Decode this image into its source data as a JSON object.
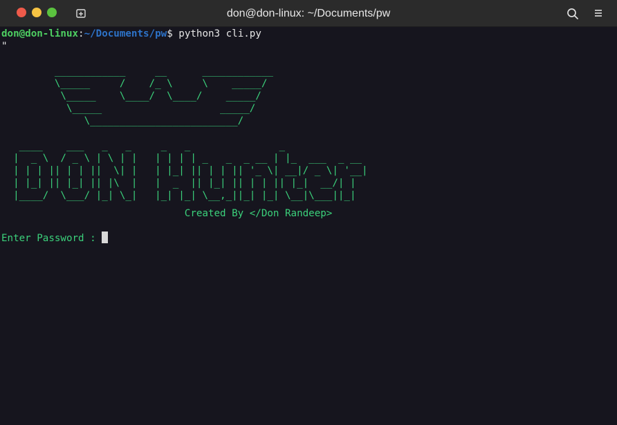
{
  "window": {
    "title": "don@don-linux: ~/Documents/pw",
    "traffic_colors": {
      "close": "#ee5a4a",
      "minimize": "#f6c343",
      "maximize": "#5bc23f"
    },
    "icons": {
      "new_tab": "new-tab-icon",
      "search": "search-icon",
      "menu": "hamburger-menu-icon"
    }
  },
  "terminal": {
    "prompt": {
      "user_host": "don@don-linux",
      "separator": ":",
      "path": "~/Documents/pw",
      "dollar": "$",
      "command": " python3 cli.py"
    },
    "quote_line": "\"",
    "logo_art": "         ____________     __      ____________\n         \\_____     /    /_ \\     \\    _____/\n          \\_____    \\____/  \\____/    _____/\n           \\_____                    _____/\n              \\_________________________/",
    "banner_art": "   ____    ___   _   _     _   _               _\n  |  _ \\  / _ \\ | \\ | |   | | | | _   _  _ __ | |_  ___  _ __\n  | | | || | | ||  \\| |   | |_| || | | || '_ \\| __|/ _ \\| '__|\n  | |_| || |_| || |\\  |   |  _  || |_| || | | || |_|  __/| |\n  |____/  \\___/ |_| \\_|   |_| |_| \\__,_||_| |_| \\__|\\___||_|",
    "credit": "                               Created By </Don Randeep>",
    "password_prompt": "Enter Password : ",
    "colors": {
      "user": "#4ed062",
      "path": "#2d73c9",
      "ascii": "#3bd17b",
      "background": "#16151e"
    }
  }
}
